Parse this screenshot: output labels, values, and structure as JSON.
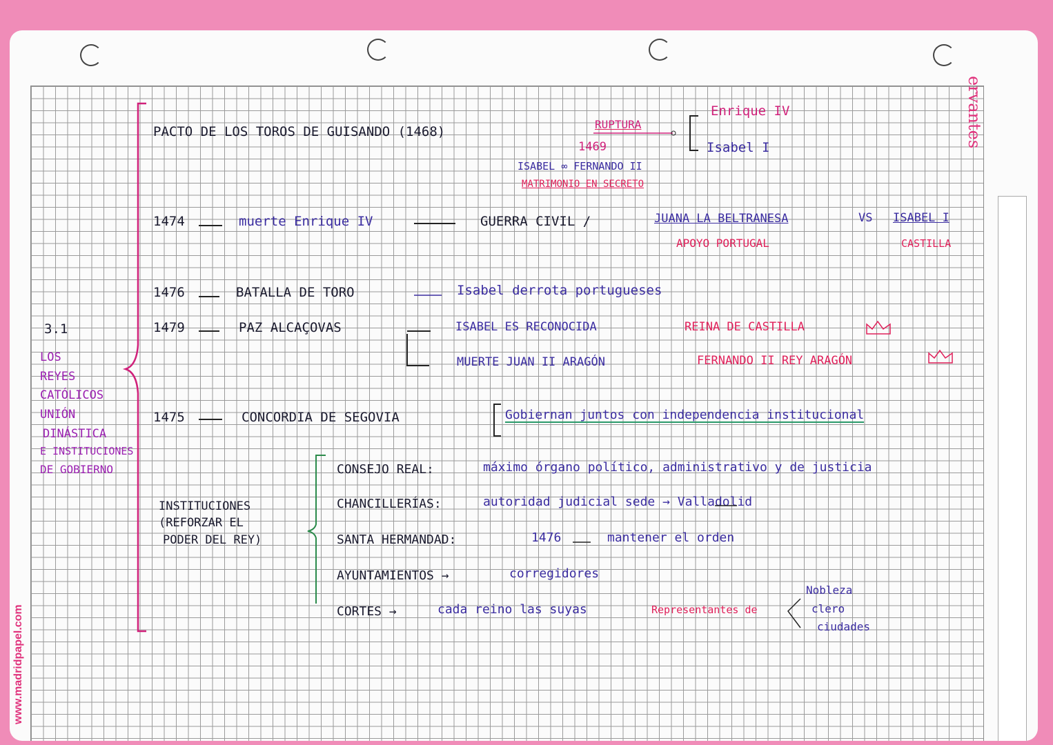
{
  "brand": "ervantes",
  "website": "www.madridpapel.com",
  "side": {
    "number": "3.1",
    "title_lines": [
      "LOS",
      "REYES",
      "CATÓLICOS",
      "UNIÓN",
      "DINÁSTICA",
      "E INSTITUCIONES",
      "DE GOBIERNO"
    ]
  },
  "pacto": {
    "text": "PACTO DE LOS TOROS DE GUISANDO (1468)",
    "ruptura": "RUPTURA",
    "year": "1469",
    "enrique": "Enrique IV",
    "isabel": "Isabel I",
    "marriage": "ISABEL ∞ FERNANDO II",
    "secret": "MATRIMONIO EN SECRETO"
  },
  "e1474": {
    "year": "1474",
    "death": "muerte Enrique IV",
    "war": "GUERRA CIVIL /",
    "juana": "JUANA LA BELTRANESA",
    "vs": "VS",
    "isabel": "ISABEL I",
    "apoyo": "APOYO PORTUGAL",
    "castilla": "CASTILLA"
  },
  "e1476": {
    "year": "1476",
    "event": "BATALLA DE TORO",
    "result": "Isabel derrota portugueses"
  },
  "e1479": {
    "year": "1479",
    "event": "PAZ ALCAÇOVAS",
    "result1": "ISABEL ES RECONOCIDA",
    "result1b": "REINA DE CASTILLA",
    "result2": "MUERTE JUAN II ARAGÓN",
    "result2b": "FERNANDO II REY ARAGÓN"
  },
  "e1475": {
    "year": "1475",
    "event": "CONCORDIA DE SEGOVIA",
    "result": "Gobiernan juntos con independencia institucional"
  },
  "instituciones": {
    "title_lines": [
      "INSTITUCIONES",
      "(REFORZAR EL",
      "PODER DEL REY)"
    ],
    "items": [
      {
        "name": "CONSEJO REAL:",
        "desc": "máximo órgano político, administrativo y de justicia"
      },
      {
        "name": "CHANCILLERÍAS:",
        "desc": "autoridad judicial  sede → Valladolid"
      },
      {
        "name": "SANTA HERMANDAD:",
        "year": "1476",
        "desc": "mantener el orden"
      },
      {
        "name": "AYUNTAMIENTOS →",
        "desc": "corregidores"
      },
      {
        "name": "CORTES →",
        "desc": "cada reino las suyas",
        "rep": "Representantes de"
      }
    ],
    "estates": [
      "Nobleza",
      "clero",
      "ciudades"
    ]
  }
}
